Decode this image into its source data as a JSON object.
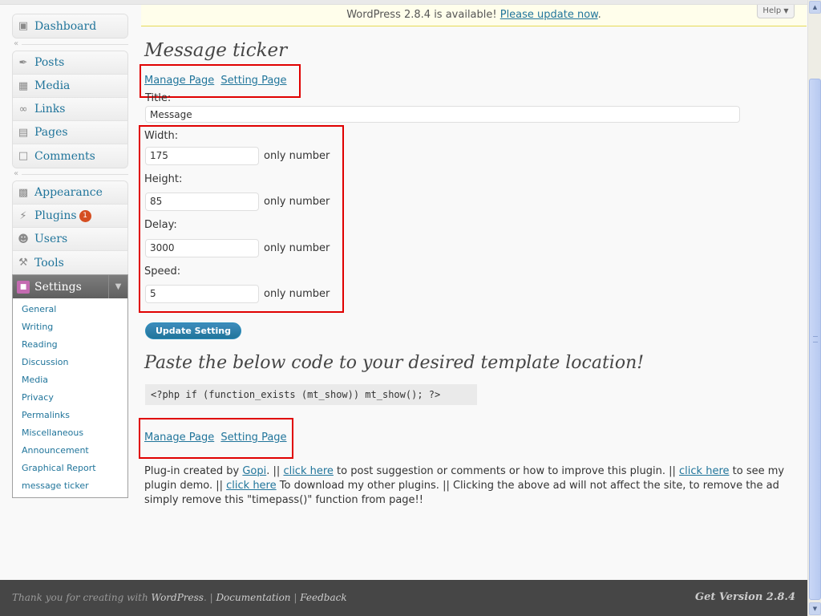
{
  "notice": {
    "text": "WordPress 2.8.4 is available! ",
    "link": "Please update now",
    "suffix": "."
  },
  "help": "Help",
  "sidebar": {
    "group1": [
      {
        "label": "Dashboard",
        "icon": "dashboard-icon"
      }
    ],
    "group2": [
      {
        "label": "Posts",
        "icon": "pin-icon"
      },
      {
        "label": "Media",
        "icon": "media-icon"
      },
      {
        "label": "Links",
        "icon": "chain-link-icon"
      },
      {
        "label": "Pages",
        "icon": "pages-icon"
      },
      {
        "label": "Comments",
        "icon": "speech-bubble-icon"
      }
    ],
    "group3": [
      {
        "label": "Appearance",
        "icon": "appearance-icon"
      },
      {
        "label": "Plugins",
        "icon": "plug-icon",
        "badge": "1"
      },
      {
        "label": "Users",
        "icon": "users-icon"
      },
      {
        "label": "Tools",
        "icon": "tools-icon"
      }
    ],
    "settings": {
      "label": "Settings",
      "icon": "settings-icon",
      "items": [
        "General",
        "Writing",
        "Reading",
        "Discussion",
        "Media",
        "Privacy",
        "Permalinks",
        "Miscellaneous",
        "Announcement",
        "Graphical Report",
        "message ticker"
      ]
    }
  },
  "page": {
    "title": "Message ticker",
    "manage_link": "Manage Page",
    "setting_link": "Setting Page",
    "title_label": "Title:",
    "title_value": "Message",
    "fields": [
      {
        "label": "Width:",
        "value": "175",
        "hint": "only number"
      },
      {
        "label": "Height:",
        "value": "85",
        "hint": "only number"
      },
      {
        "label": "Delay:",
        "value": "3000",
        "hint": "only number"
      },
      {
        "label": "Speed:",
        "value": "5",
        "hint": "only number"
      }
    ],
    "button": "Update Setting",
    "code_heading": "Paste the below code to your desired template location!",
    "code": "<?php if (function_exists (mt_show)) mt_show(); ?>",
    "credits": {
      "t1": "Plug-in created by ",
      "gopi": "Gopi",
      "t2": ". || ",
      "click1": "click here",
      "t3": " to post suggestion or comments or how to improve this plugin. || ",
      "click2": "click here",
      "t4": " to see my plugin demo. || ",
      "click3": "click here",
      "t5": " To download my other plugins. || Clicking the above ad will not affect the site, to remove the ad simply remove this \"timepass()\" function from page!!"
    }
  },
  "footer": {
    "thanks": "Thank you for creating with ",
    "wordpress": "WordPress",
    "sep1": ". | ",
    "documentation": "Documentation",
    "sep2": " | ",
    "feedback": "Feedback",
    "version": "Get Version 2.8.4"
  }
}
